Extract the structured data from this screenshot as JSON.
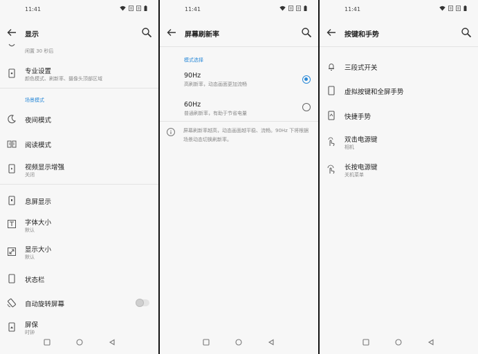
{
  "status_bar": {
    "time": "11:41"
  },
  "display": {
    "title": "显示",
    "top_partial_subtitle": "闲置 30 秒后",
    "pro_settings": {
      "label": "专业设置",
      "subtitle": "颜色模式、刷新率、摄像头顶部区域"
    },
    "section_scene": "场景模式",
    "night_mode": "夜间模式",
    "reading_mode": "阅读模式",
    "video_enhance": {
      "label": "视频显示增强",
      "subtitle": "关闭"
    },
    "ambient_display": "息屏显示",
    "font_size": {
      "label": "字体大小",
      "subtitle": "默认"
    },
    "display_size": {
      "label": "显示大小",
      "subtitle": "默认"
    },
    "status_bar_item": "状态栏",
    "auto_rotate": "自动旋转屏幕",
    "screensaver": {
      "label": "屏保",
      "subtitle": "时钟"
    }
  },
  "refresh_rate": {
    "title": "屏幕刷新率",
    "section": "模式选择",
    "options": [
      {
        "label": "90Hz",
        "subtitle": "高刷新率，动态画面更加流畅",
        "selected": true
      },
      {
        "label": "60Hz",
        "subtitle": "普通刷新率，有助于节省电量",
        "selected": false
      }
    ],
    "note": "屏幕刷新率越高，动态画面越平稳、流畅。90Hz 下将根据场景动态切换刷新率。"
  },
  "buttons_gestures": {
    "title": "按键和手势",
    "items": [
      {
        "label": "三段式开关",
        "subtitle": ""
      },
      {
        "label": "虚拟按键和全屏手势",
        "subtitle": ""
      },
      {
        "label": "快捷手势",
        "subtitle": ""
      },
      {
        "label": "双击电源键",
        "subtitle": "相机"
      },
      {
        "label": "长按电源键",
        "subtitle": "关机菜单"
      }
    ]
  },
  "colors": {
    "accent": "#2b8ad8",
    "background": "#f7f7f7",
    "divider": "#111111"
  }
}
